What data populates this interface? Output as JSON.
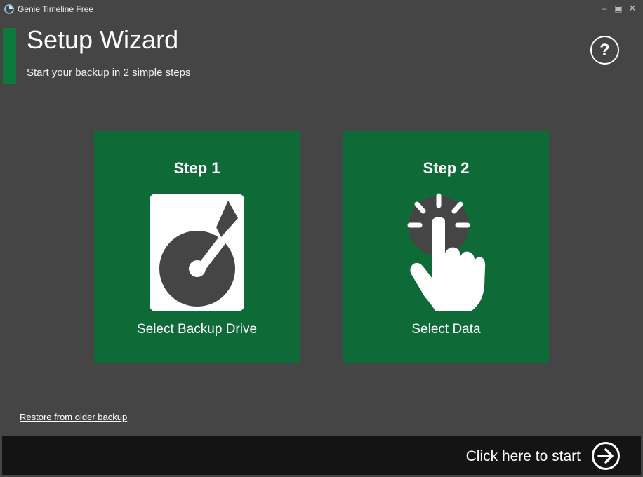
{
  "window": {
    "title": "Genie Timeline Free",
    "minimize_icon": "minimize-icon",
    "maximize_icon": "maximize-icon",
    "close_icon": "close-icon"
  },
  "header": {
    "title": "Setup Wizard",
    "subtitle": "Start your backup in 2 simple steps",
    "help_symbol": "?"
  },
  "steps": [
    {
      "heading": "Step 1",
      "label": "Select Backup Drive",
      "icon": "hard-drive-icon"
    },
    {
      "heading": "Step 2",
      "label": "Select Data",
      "icon": "touch-select-icon"
    }
  ],
  "footer": {
    "restore_link": "Restore from older backup",
    "start_label": "Click here to start",
    "start_icon": "arrow-right-circle-icon"
  },
  "colors": {
    "background": "#454545",
    "accent_green": "#0d7a3d",
    "tile_green": "#0e6b37",
    "bottom_bar": "#141414"
  }
}
